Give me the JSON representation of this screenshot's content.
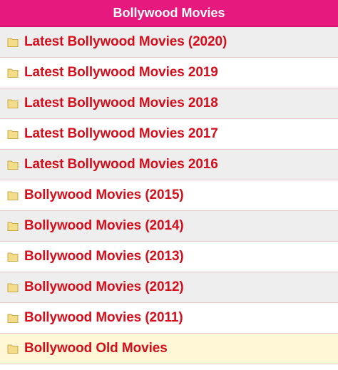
{
  "header": {
    "title": "Bollywood Movies"
  },
  "colors": {
    "header_bg": "#e5197e",
    "link_text": "#d40f1b",
    "row_alt": "#eeeeee",
    "row_last": "#fff7d6"
  },
  "items": [
    {
      "label": "Latest Bollywood Movies (2020)",
      "icon": "folder-icon"
    },
    {
      "label": "Latest Bollywood Movies 2019",
      "icon": "folder-icon"
    },
    {
      "label": "Latest Bollywood Movies 2018",
      "icon": "folder-icon"
    },
    {
      "label": "Latest Bollywood Movies 2017",
      "icon": "folder-icon"
    },
    {
      "label": "Latest Bollywood Movies 2016",
      "icon": "folder-icon"
    },
    {
      "label": "Bollywood Movies (2015)",
      "icon": "folder-icon"
    },
    {
      "label": "Bollywood Movies (2014)",
      "icon": "folder-icon"
    },
    {
      "label": "Bollywood Movies (2013)",
      "icon": "folder-icon"
    },
    {
      "label": "Bollywood Movies (2012)",
      "icon": "folder-icon"
    },
    {
      "label": "Bollywood Movies (2011)",
      "icon": "folder-icon"
    },
    {
      "label": "Bollywood Old Movies",
      "icon": "folder-icon"
    }
  ]
}
